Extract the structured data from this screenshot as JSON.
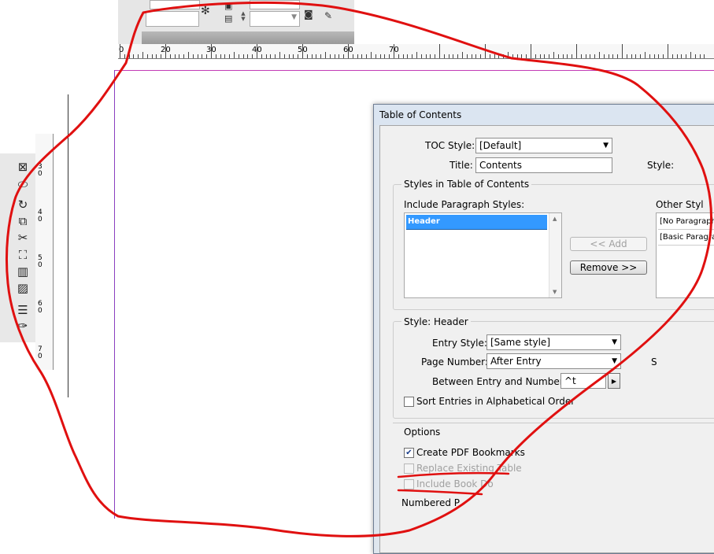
{
  "ruler": {
    "labels": [
      "0",
      "20",
      "30",
      "40",
      "50",
      "60",
      "70"
    ]
  },
  "vruler": {
    "labels": [
      "3",
      "0",
      "4",
      "0",
      "5",
      "0",
      "6",
      "0",
      "7",
      "0"
    ]
  },
  "dialog": {
    "title": "Table of Contents",
    "toc_style_label": "TOC Style:",
    "toc_style_value": "[Default]",
    "title_label": "Title:",
    "title_value": "Contents",
    "style_label": "Style:",
    "styles_group_title": "Styles in Table of Contents",
    "include_label": "Include Paragraph Styles:",
    "include_items": [
      "Header"
    ],
    "other_label": "Other Styl",
    "other_items": [
      "[No Paragraph",
      "[Basic Paragrap"
    ],
    "add_button": "<< Add",
    "remove_button": "Remove >>",
    "style_header_group_title": "Style: Header",
    "entry_style_label": "Entry Style:",
    "entry_style_value": "[Same style]",
    "page_number_label": "Page Number:",
    "page_number_value": "After Entry",
    "page_number_right_label": "S",
    "between_label": "Between Entry and Number:",
    "between_value": "^t",
    "sort_label": "Sort Entries in Alphabetical Order",
    "options_title": "Options",
    "create_pdf_label": "Create PDF Bookmarks",
    "replace_label": "Replace Existing Table",
    "include_book_label": "Include Book Do",
    "numbered_label": "Numbered P"
  },
  "colors": {
    "annotation": "#e01010",
    "selection": "#3399ff",
    "guide_top": "#c33cb6",
    "guide_left": "#8a3fc0"
  },
  "icons": [
    "text-frame-icon",
    "ellipse-icon",
    "rotate-icon",
    "scale-icon",
    "scissors-icon",
    "free-transform-icon",
    "gradient-icon",
    "gradient-feather-icon",
    "note-icon",
    "eyedropper-icon"
  ]
}
